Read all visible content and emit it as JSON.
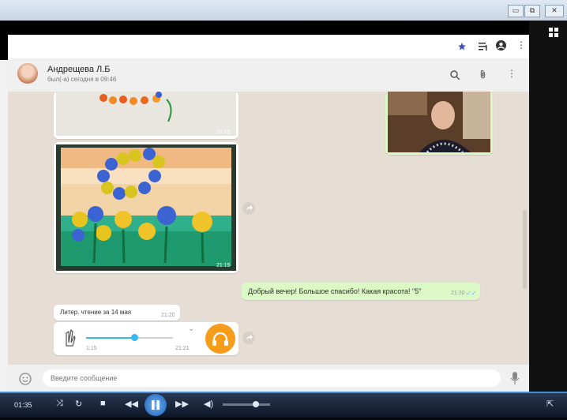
{
  "window": {
    "minimize_glyph": "▭",
    "restore_glyph": "⧉",
    "close_glyph": "✕"
  },
  "wa_top": {
    "star_icon": "star-icon",
    "menu_glyph": "⋮"
  },
  "contact": {
    "name": "Андрещева Л.Б",
    "status": "был(-а) сегодня в 09:46"
  },
  "messages": {
    "img1_time": "21:15",
    "img2_time": "21:15",
    "out_text": "Добрый вечер! Большое спасибо! Какая красота! \"5\"",
    "out_time": "21:20",
    "doc_text": "Литер. чтение за 14 мая",
    "doc_time": "21:20",
    "audio_elapsed": "1:15",
    "audio_time": "21:21",
    "audio_progress": 0.55
  },
  "composer": {
    "placeholder": "Введите сообщение"
  },
  "player": {
    "time": "01:35"
  },
  "colors": {
    "accent": "#3f51b5",
    "orange": "#f59c1a",
    "audio_blue": "#34b7f1"
  }
}
